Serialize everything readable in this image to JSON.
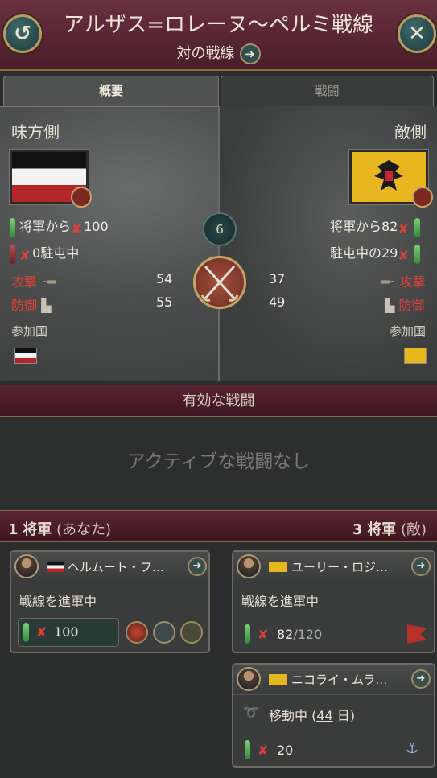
{
  "header": {
    "title": "アルザス=ロレーヌ〜ペルミ戦線",
    "subtitle": "対の戦線",
    "back_icon": "back-arrow-icon",
    "close_icon": "close-icon",
    "subtitle_arrow": "➜"
  },
  "tabs": [
    {
      "label": "概要",
      "active": true
    },
    {
      "label": "戦闘",
      "active": false
    }
  ],
  "overview": {
    "left": {
      "side_label": "味方側",
      "generals_text": "将軍から",
      "generals_value": "100",
      "garrison_value": "0",
      "garrison_text": "駐屯中",
      "attack_label": "攻撃",
      "attack_value": "54",
      "defense_label": "防御",
      "defense_value": "55",
      "participants_label": "参加国"
    },
    "right": {
      "side_label": "敵側",
      "generals_text": "将軍から",
      "generals_value": "82",
      "garrison_text": "駐屯中の",
      "garrison_value": "29",
      "attack_label": "攻撃",
      "attack_value": "37",
      "defense_label": "防御",
      "defense_value": "49",
      "participants_label": "参加国"
    },
    "round_number": "6"
  },
  "battles": {
    "section_title": "有効な戦闘",
    "empty_text": "アクティブな戦闘なし"
  },
  "generals": {
    "left_count": "1",
    "left_label": "将軍",
    "left_suffix": "(あなた)",
    "right_count": "3",
    "right_label": "将軍",
    "right_suffix": "(敵)",
    "ours": [
      {
        "name": "ヘルムート・フ…",
        "order": "戦線を進軍中",
        "troops": "100"
      }
    ],
    "enemy": [
      {
        "name": "ユーリー・ロジ…",
        "order": "戦線を進軍中",
        "troops": "82",
        "troops_max": "/120"
      },
      {
        "name": "ニコライ・ムラ…",
        "order_prefix": "移動中 (",
        "days": "44",
        "order_suffix": " 日)",
        "troops": "20"
      }
    ]
  },
  "colors": {
    "header_bg": "#5a2533",
    "accent_gold": "#b79a64",
    "attack_red": "#e0403a",
    "green_bar": "#3c9a44"
  }
}
